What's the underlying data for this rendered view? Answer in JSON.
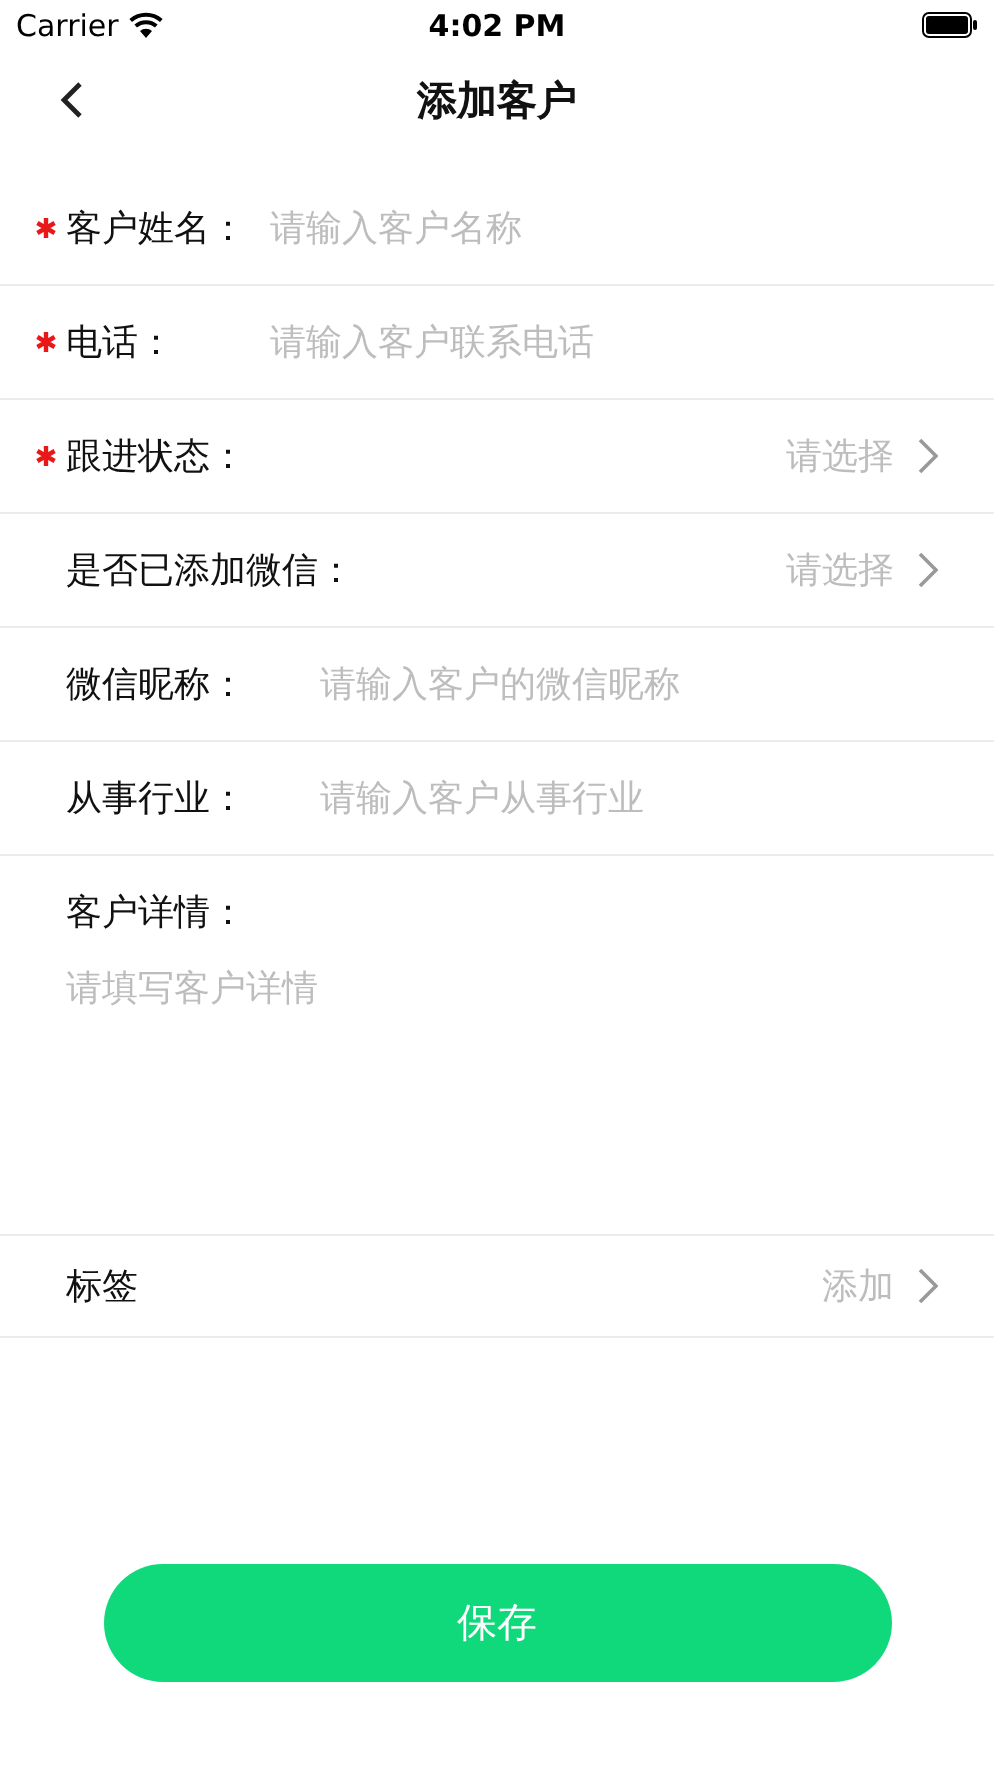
{
  "status_bar": {
    "carrier": "Carrier",
    "time": "4:02 PM"
  },
  "nav": {
    "title": "添加客户"
  },
  "fields": [
    {
      "kind": "input",
      "required": true,
      "label": "客户姓名：",
      "placeholder": "请输入客户名称"
    },
    {
      "kind": "input",
      "required": true,
      "label": "电话：",
      "placeholder": "请输入客户联系电话"
    },
    {
      "kind": "select",
      "required": true,
      "label": "跟进状态：",
      "placeholder": "请选择"
    },
    {
      "kind": "select",
      "required": false,
      "label": "是否已添加微信：",
      "placeholder": "请选择"
    },
    {
      "kind": "input",
      "required": false,
      "label": "微信昵称：",
      "placeholder": "请输入客户的微信昵称"
    },
    {
      "kind": "input",
      "required": false,
      "label": "从事行业：",
      "placeholder": "请输入客户从事行业"
    }
  ],
  "details": {
    "label": "客户详情：",
    "placeholder": "请填写客户详情"
  },
  "tags": {
    "label": "标签",
    "action": "添加"
  },
  "save_button": "保存"
}
